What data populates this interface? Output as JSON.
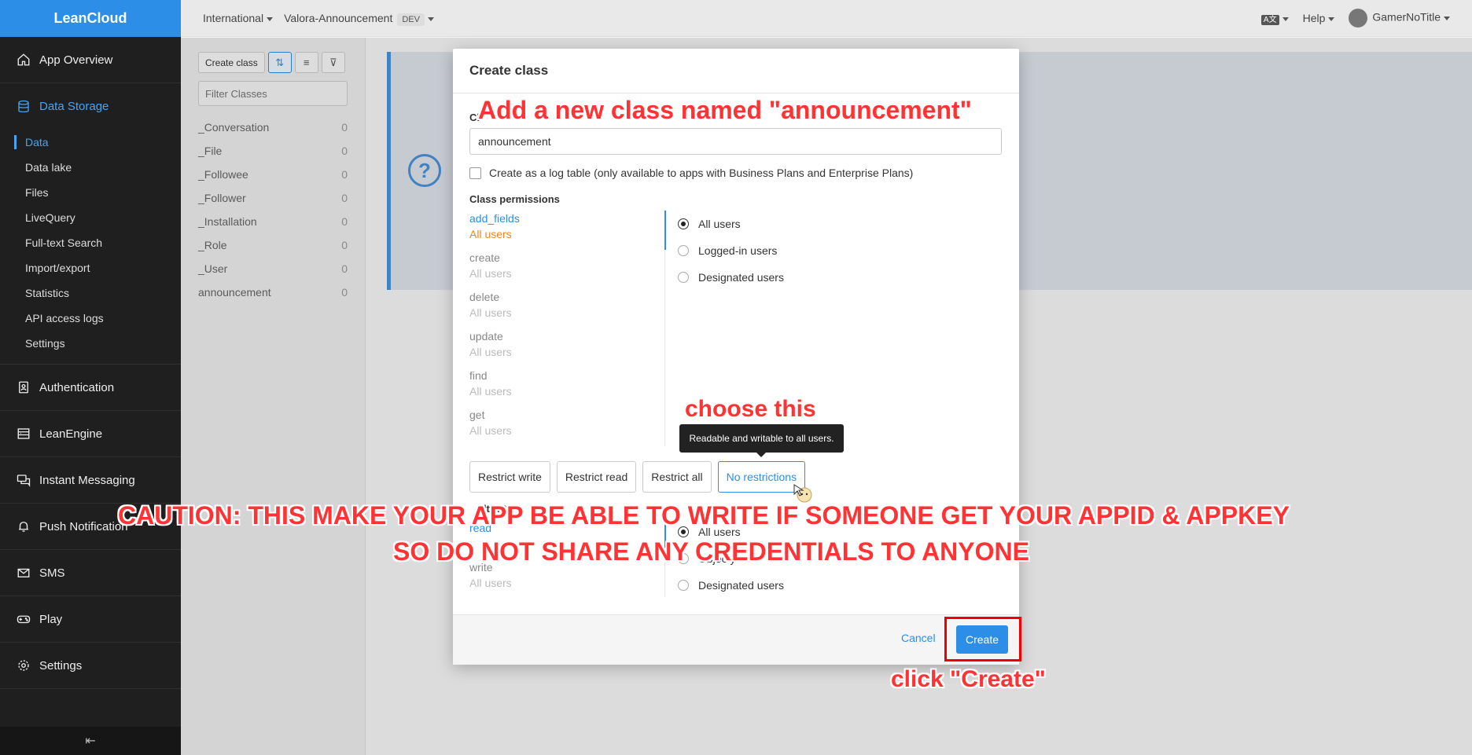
{
  "brand": "LeanCloud",
  "sidebar": {
    "items": [
      {
        "label": "App Overview",
        "icon": "home-icon"
      },
      {
        "label": "Data Storage",
        "icon": "database-icon"
      },
      {
        "label": "Authentication",
        "icon": "id-card-icon"
      },
      {
        "label": "LeanEngine",
        "icon": "server-icon"
      },
      {
        "label": "Instant Messaging",
        "icon": "chat-icon"
      },
      {
        "label": "Push Notification",
        "icon": "bell-icon"
      },
      {
        "label": "SMS",
        "icon": "mail-icon"
      },
      {
        "label": "Play",
        "icon": "gamepad-icon"
      },
      {
        "label": "Settings",
        "icon": "gear-icon"
      }
    ],
    "subitems": [
      "Data",
      "Data lake",
      "Files",
      "LiveQuery",
      "Full-text Search",
      "Import/export",
      "Statistics",
      "API access logs",
      "Settings"
    ],
    "collapse_glyph": "⇤"
  },
  "topbar": {
    "region": "International",
    "app": "Valora-Announcement",
    "env": "DEV",
    "lang": "A文",
    "help": "Help",
    "user": "GamerNoTitle"
  },
  "classes": {
    "create_label": "Create class",
    "filter_placeholder": "Filter Classes",
    "list": [
      {
        "name": "_Conversation",
        "count": "0"
      },
      {
        "name": "_File",
        "count": "0"
      },
      {
        "name": "_Followee",
        "count": "0"
      },
      {
        "name": "_Follower",
        "count": "0"
      },
      {
        "name": "_Installation",
        "count": "0"
      },
      {
        "name": "_Role",
        "count": "0"
      },
      {
        "name": "_User",
        "count": "0"
      },
      {
        "name": "announcement",
        "count": "0"
      }
    ]
  },
  "help_glyph": "?",
  "modal": {
    "title": "Create class",
    "class_name_label": "Cl",
    "class_name_value": "announcement",
    "log_table_label": "Create as a log table (only available to apps with Business Plans and Enterprise Plans)",
    "perm_title": "Class permissions",
    "permissions": [
      {
        "name": "add_fields",
        "value": "All users"
      },
      {
        "name": "create",
        "value": "All users"
      },
      {
        "name": "delete",
        "value": "All users"
      },
      {
        "name": "update",
        "value": "All users"
      },
      {
        "name": "find",
        "value": "All users"
      },
      {
        "name": "get",
        "value": "All users"
      }
    ],
    "radio_options": [
      "All users",
      "Logged-in users",
      "Designated users"
    ],
    "restrict_buttons": [
      "Restrict write",
      "Restrict read",
      "Restrict all",
      "No restrictions"
    ],
    "tooltip": "Readable and writable to all users.",
    "default_acl_title": "ult AC",
    "acl_items": [
      {
        "name": "read",
        "value": ""
      },
      {
        "name": "write",
        "value": "All users"
      }
    ],
    "acl_radios": [
      "All users",
      "Objec         y",
      "Designated users"
    ],
    "cancel": "Cancel",
    "create": "Create"
  },
  "annotations": {
    "top": "Add a new class named \"announcement\"",
    "choose": "choose this",
    "caution1": "CAUTION: THIS MAKE YOUR APP BE ABLE TO WRITE IF SOMEONE GET YOUR APPID & APPKEY",
    "caution2": "SO DO NOT SHARE ANY CREDENTIALS TO ANYONE",
    "click": "click \"Create\""
  },
  "colors": {
    "accent": "#2c8ee6",
    "annotation": "#ff3333",
    "sidebar_bg": "#1f1f1f"
  }
}
